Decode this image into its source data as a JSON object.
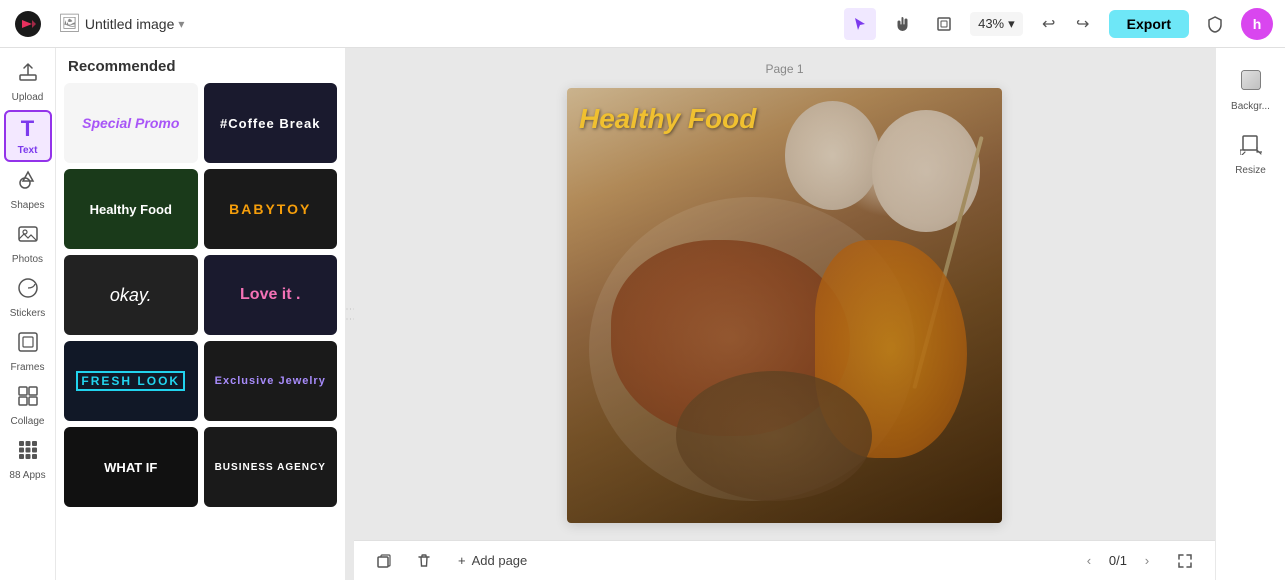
{
  "topbar": {
    "logo_alt": "Capcut Logo",
    "doc_title": "Untitled image",
    "doc_icon": "🖼",
    "zoom_level": "43%",
    "export_label": "Export",
    "avatar_letter": "h",
    "undo_title": "Undo",
    "redo_title": "Redo"
  },
  "sidebar": {
    "items": [
      {
        "id": "upload",
        "label": "Upload",
        "icon": "⬆"
      },
      {
        "id": "text",
        "label": "Text",
        "icon": "T",
        "active": true
      },
      {
        "id": "shapes",
        "label": "Shapes",
        "icon": "◇"
      },
      {
        "id": "photos",
        "label": "Photos",
        "icon": "🖼"
      },
      {
        "id": "stickers",
        "label": "Stickers",
        "icon": "⭐"
      },
      {
        "id": "frames",
        "label": "Frames",
        "icon": "⬜"
      },
      {
        "id": "collage",
        "label": "Collage",
        "icon": "⊞"
      },
      {
        "id": "apps",
        "label": "88 Apps",
        "icon": "⊞"
      }
    ]
  },
  "text_panel": {
    "title": "Recommended",
    "styles": [
      {
        "id": "special-promo",
        "label": "Special Promo",
        "bg": "#f5f5f5",
        "text_color": "#a855f7",
        "style_class": "special-promo"
      },
      {
        "id": "coffee-break",
        "label": "#Coffee Break",
        "bg": "#1a1a2e",
        "text_color": "#ffffff",
        "style_class": "coffee-break"
      },
      {
        "id": "healthy-food",
        "label": "Healthy Food",
        "bg": "#1a3a1a",
        "text_color": "#ffffff",
        "style_class": "healthy-food-text"
      },
      {
        "id": "babytoy",
        "label": "BABYTOY",
        "bg": "#1a1a1a",
        "text_color": "#f59e0b",
        "style_class": "babytoy-text"
      },
      {
        "id": "okay",
        "label": "okay.",
        "bg": "#222222",
        "text_color": "#ffffff",
        "style_class": "okay-text"
      },
      {
        "id": "love-it",
        "label": "Love it .",
        "bg": "#1a1a2e",
        "text_color": "#f472b6",
        "style_class": "loveit-text"
      },
      {
        "id": "fresh-look",
        "label": "FRESH LOOK",
        "bg": "#111827",
        "text_color": "#22d3ee",
        "style_class": "freshlook-text"
      },
      {
        "id": "exclusive-jewelry",
        "label": "Exclusive Jewelry",
        "bg": "#1a1a1a",
        "text_color": "#a78bfa",
        "style_class": "excjewelry-text"
      },
      {
        "id": "what-if",
        "label": "WHAT IF",
        "bg": "#111111",
        "text_color": "#ffffff",
        "style_class": "whatif-text"
      },
      {
        "id": "business-agency",
        "label": "BUSINESS AGENCY",
        "bg": "#1a1a1a",
        "text_color": "#ffffff",
        "style_class": "bizagency-text"
      }
    ]
  },
  "canvas": {
    "page_label": "Page 1",
    "image_title": "Healthy Food",
    "zoom": "43%"
  },
  "right_panel": {
    "items": [
      {
        "id": "background",
        "label": "Backgr...",
        "icon": "⬜"
      },
      {
        "id": "resize",
        "label": "Resize",
        "icon": "⤡"
      }
    ]
  },
  "bottombar": {
    "add_page_label": "Add page",
    "page_current": "0/1",
    "page_prev": "‹",
    "page_next": "›"
  }
}
